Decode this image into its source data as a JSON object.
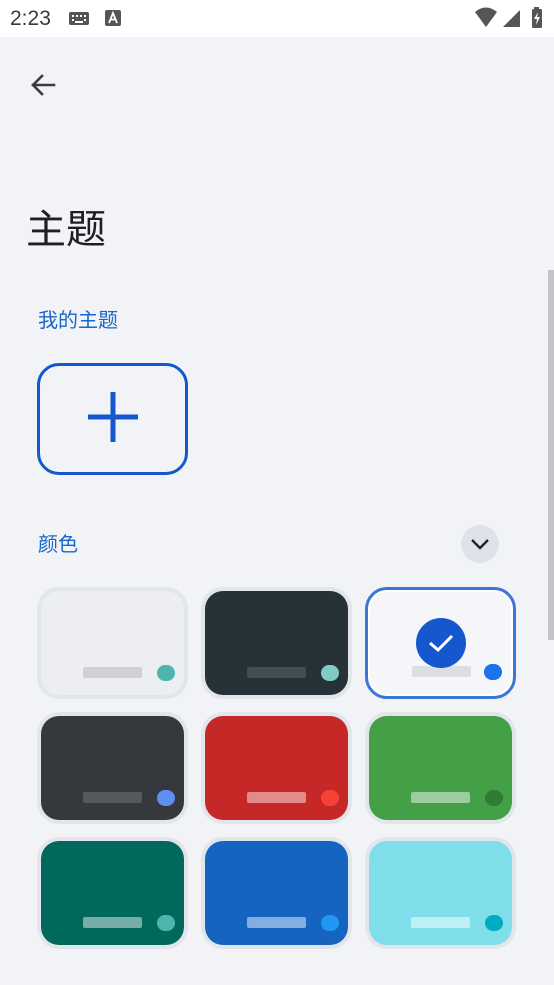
{
  "status_bar": {
    "time": "2:23",
    "icons": [
      "keyboard-icon",
      "text-a-icon",
      "wifi-icon",
      "signal-icon",
      "battery-icon"
    ]
  },
  "header": {
    "back_icon": "arrow-back-icon",
    "title": "主题"
  },
  "sections": {
    "my_themes": {
      "label": "我的主题",
      "add_icon": "plus-icon"
    },
    "colors": {
      "label": "颜色",
      "expand_icon": "chevron-down-icon"
    }
  },
  "color_themes": [
    {
      "name": "light-gray",
      "background": "#eceef1",
      "bar": "#cfd1d4",
      "accent": "#4db6ac",
      "selected": false
    },
    {
      "name": "dark-slate",
      "background": "#263238",
      "bar": "#434c52",
      "accent": "#80cbc4",
      "selected": false
    },
    {
      "name": "white-blue",
      "background": "#f4f6f9",
      "bar": "#dcdee2",
      "accent": "#1a73e8",
      "selected": true
    },
    {
      "name": "charcoal",
      "background": "#35393e",
      "bar": "#55585d",
      "accent": "#5e8ff0",
      "selected": false
    },
    {
      "name": "red",
      "background": "#c62828",
      "bar": "#e38b8b",
      "accent": "#f44336",
      "selected": false
    },
    {
      "name": "green",
      "background": "#43a047",
      "bar": "#9ccd9e",
      "accent": "#2e7d32",
      "selected": false
    },
    {
      "name": "teal",
      "background": "#00695c",
      "bar": "#77ada6",
      "accent": "#4db6ac",
      "selected": false
    },
    {
      "name": "blue",
      "background": "#1565c0",
      "bar": "#83aee0",
      "accent": "#2196f3",
      "selected": false
    },
    {
      "name": "cyan",
      "background": "#80deea",
      "bar": "#bfeef4",
      "accent": "#00acc1",
      "selected": false
    }
  ],
  "colors": {
    "accent": "#1557cf",
    "background": "#f1f3f6",
    "section_label": "#1a66c9"
  }
}
